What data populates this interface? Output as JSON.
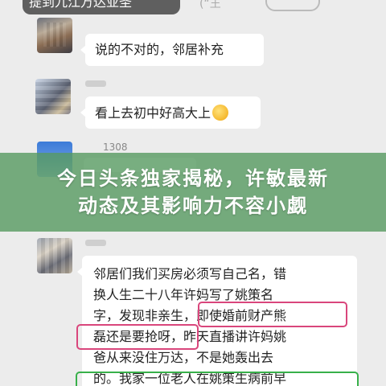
{
  "header": {
    "top_label": "提到九江万达亚圣",
    "top_faint": "(“王"
  },
  "chat": {
    "msg1": "说的不对的，邻居补充",
    "msg2": "看上去初中好高大上",
    "msg2_emoji": "grinning-sweat-emoji",
    "number_label": "1308",
    "msg3_lines": [
      "邻居们我们买房必须写自己名，错",
      "换人生二十八年许妈写了姚策名",
      "字，发现非亲生，即使婚前财产熊",
      "磊还是要抢呀，昨天直播讲许妈姚",
      "爸从来没住万达，不是她轰出去",
      "的。我家一位老人在姚策生病前早"
    ]
  },
  "banner": {
    "line1": "今日头条独家揭秘，许敏最新",
    "line2": "动态及其影响力不容小觑"
  },
  "colors": {
    "banner": "#569a60",
    "highlight_red": "#d9467c",
    "highlight_green": "#38b04a",
    "bubble": "#ffffff",
    "background": "#ececec"
  }
}
